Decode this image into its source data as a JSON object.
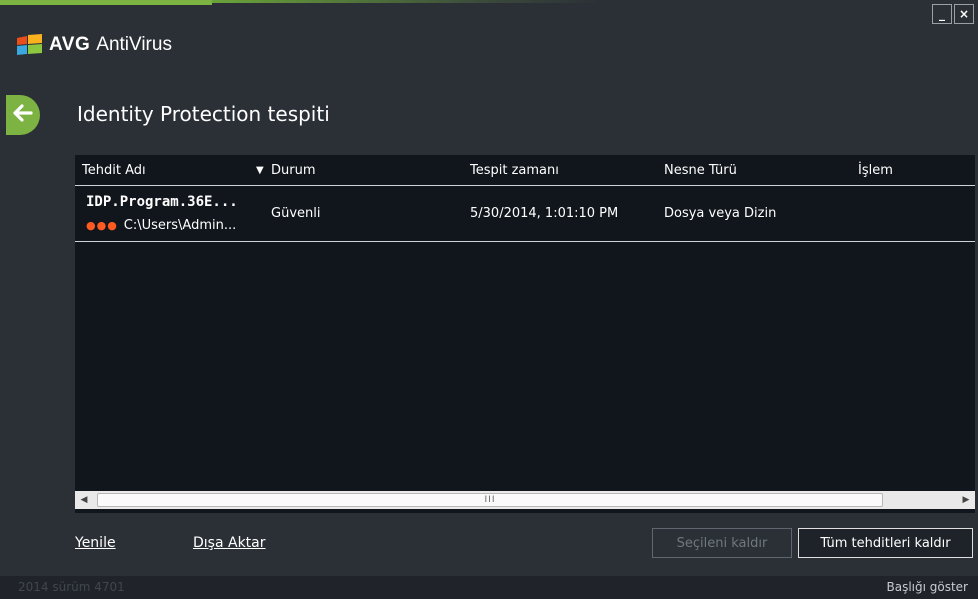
{
  "window": {
    "minimize_label": "_",
    "close_label": "×"
  },
  "brand": {
    "name": "AVG",
    "product": "AntiVirus",
    "logo_icon": "avg-logo-icon"
  },
  "page": {
    "title": "Identity Protection tespiti",
    "back_icon": "arrow-left-icon"
  },
  "table": {
    "columns": [
      {
        "label": "Tehdit Adı",
        "sort_indicator": "▼"
      },
      {
        "label": "Durum"
      },
      {
        "label": "Tespit zamanı"
      },
      {
        "label": "Nesne Türü"
      },
      {
        "label": "İşlem"
      }
    ],
    "rows": [
      {
        "name": "IDP.Program.36E...",
        "severity_dots": "●●●",
        "path": "C:\\Users\\Admin...",
        "status": "Güvenli",
        "detected_at": "5/30/2014, 1:01:10 PM",
        "object_type": "Dosya veya Dizin",
        "action": ""
      }
    ],
    "scrollbar": {
      "left_arrow": "◀",
      "right_arrow": "▶",
      "grip": "III"
    }
  },
  "actions": {
    "refresh": "Yenile",
    "export": "Dışa Aktar",
    "remove_selected": "Seçileni kaldır",
    "remove_all": "Tüm tehditleri kaldır"
  },
  "footer": {
    "version": "2014  sürüm 4701",
    "show_header": "Başlığı göster"
  },
  "colors": {
    "accent_green": "#7cb342",
    "background": "#2b3036",
    "panel": "#11161d",
    "severity": "#ff5a1f"
  }
}
